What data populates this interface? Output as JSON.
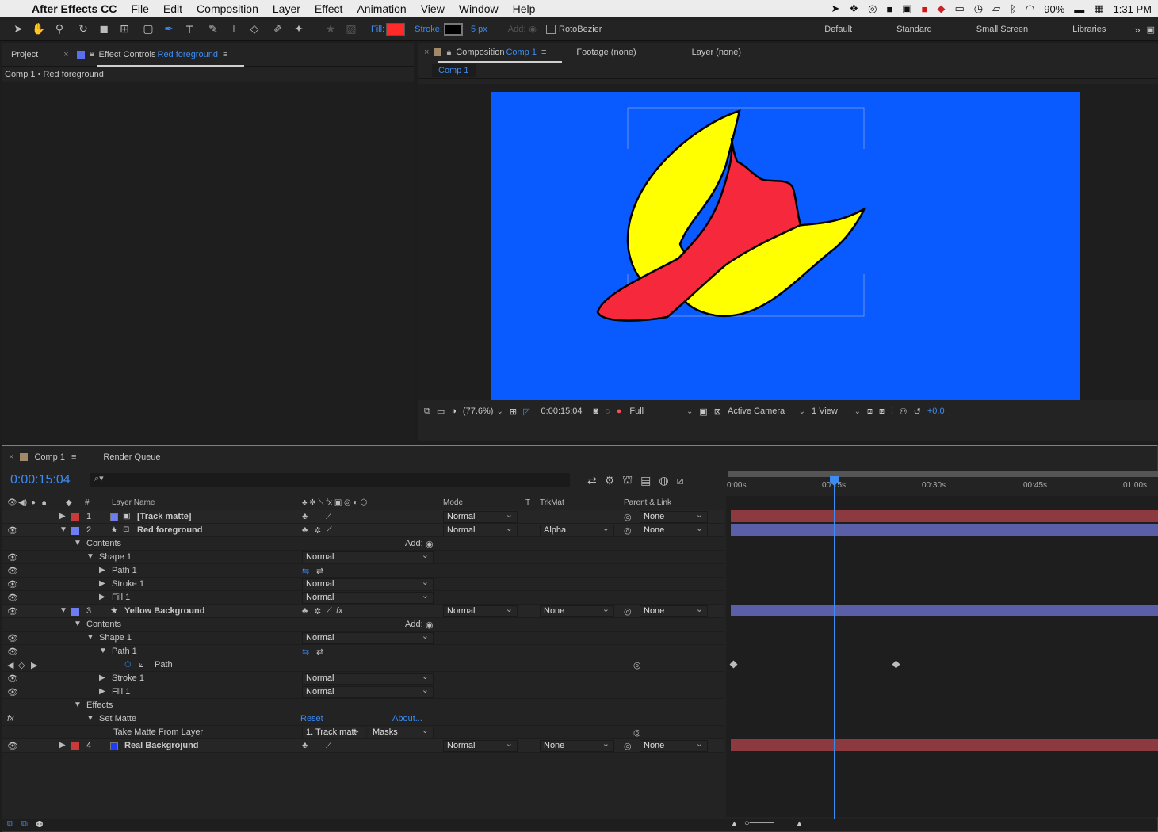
{
  "menubar": {
    "app_name": "After Effects CC",
    "items": [
      "File",
      "Edit",
      "Composition",
      "Layer",
      "Effect",
      "Animation",
      "View",
      "Window",
      "Help"
    ],
    "battery": "90%",
    "time": "1:31 PM"
  },
  "toolbar": {
    "fill_label": "Fill:",
    "fill_color": "#ff2a2a",
    "stroke_label": "Stroke:",
    "stroke_color": "#000000",
    "stroke_width": "5 px",
    "add_label": "Add:",
    "rotobezier_label": "RotoBezier",
    "workspaces": [
      "Default",
      "Standard",
      "Small Screen",
      "Libraries"
    ]
  },
  "project_panel": {
    "tab_project": "Project",
    "tab_effect_controls": "Effect Controls",
    "effect_controls_target": "Red foreground",
    "breadcrumb": "Comp 1 • Red foreground"
  },
  "composition_panel": {
    "tab_composition": "Composition",
    "composition_name": "Comp 1",
    "tab_footage": "Footage (none)",
    "tab_layer": "Layer (none)",
    "subtab": "Comp 1",
    "background_color": "#0a5bff",
    "zoom": "(77.6%)",
    "timecode": "0:00:15:04",
    "resolution": "Full",
    "camera": "Active Camera",
    "views": "1 View",
    "exposure": "+0.0"
  },
  "timeline": {
    "tab_comp": "Comp 1",
    "tab_render_queue": "Render Queue",
    "timecode": "0:00:15:04",
    "search_placeholder": "⌕▾",
    "headers": {
      "layer_name": "Layer Name",
      "mode": "Mode",
      "t": "T",
      "trkmat": "TrkMat",
      "parent": "Parent & Link",
      "hash": "#"
    },
    "ruler_labels": [
      "0:00s",
      "00:15s",
      "00:30s",
      "00:45s",
      "01:00s"
    ],
    "add_label": "Add:",
    "layers": [
      {
        "num": "1",
        "name": "[Track matte]",
        "mode": "Normal",
        "trkmat": "",
        "parent": "None",
        "label_color": "#c93a3a",
        "bar_color": "#8c3a3f"
      },
      {
        "num": "2",
        "name": "Red foreground",
        "mode": "Normal",
        "trkmat": "Alpha",
        "parent": "None",
        "label_color": "#6e7df0",
        "bar_color": "#5a5fa7"
      },
      {
        "num": "3",
        "name": "Yellow Background",
        "mode": "Normal",
        "trkmat": "None",
        "parent": "None",
        "label_color": "#6e7df0",
        "bar_color": "#5a5fa7"
      },
      {
        "num": "4",
        "name": "Real Backgrojund",
        "mode": "Normal",
        "trkmat": "None",
        "parent": "None",
        "label_color": "#c93a3a",
        "bar_color": "#8c3a3f"
      }
    ],
    "props": {
      "contents": "Contents",
      "shape1": "Shape 1",
      "path1": "Path 1",
      "stroke1": "Stroke 1",
      "fill1": "Fill 1",
      "path": "Path",
      "effects": "Effects",
      "set_matte": "Set Matte",
      "reset": "Reset",
      "about": "About...",
      "take_matte_from": "Take Matte From Layer",
      "take_matte_value": "1. Track matt",
      "masks_value": "Masks",
      "normal": "Normal"
    }
  }
}
